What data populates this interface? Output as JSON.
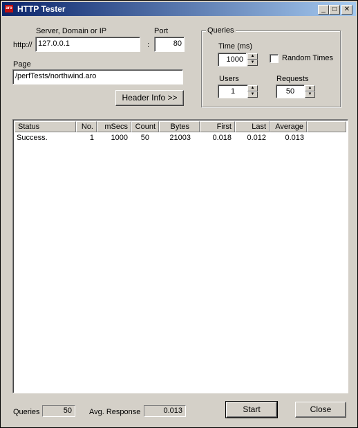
{
  "window": {
    "title": "HTTP Tester",
    "icon_text": "aro"
  },
  "titlebar_buttons": {
    "minimize": "_",
    "maximize": "□",
    "close": "✕"
  },
  "server": {
    "label": "Server, Domain or IP",
    "prefix": "http://",
    "value": "127.0.0.1"
  },
  "port": {
    "label": "Port",
    "separator": ":",
    "value": "80"
  },
  "page": {
    "label": "Page",
    "value": "/perfTests/northwind.aro"
  },
  "header_info_button": "Header Info >>",
  "queries_group": {
    "legend": "Queries",
    "time_label": "Time  (ms)",
    "time_value": "1000",
    "random_times_label": "Random Times",
    "random_times_checked": false,
    "users_label": "Users",
    "users_value": "1",
    "requests_label": "Requests",
    "requests_value": "50"
  },
  "results": {
    "columns": [
      "Status",
      "No.",
      "mSecs",
      "Count",
      "Bytes",
      "First",
      "Last",
      "Average"
    ],
    "rows": [
      [
        "Success.",
        "1",
        "1000",
        "50",
        "21003",
        "0.018",
        "0.012",
        "0.013"
      ]
    ]
  },
  "footer": {
    "queries_label": "Queries",
    "queries_value": "50",
    "avg_response_label": "Avg. Response",
    "avg_response_value": "0.013",
    "start_button": "Start",
    "close_button": "Close"
  },
  "colors": {
    "titlebar_start": "#0a246a",
    "titlebar_end": "#a6caf0",
    "face": "#d4d0c8"
  }
}
